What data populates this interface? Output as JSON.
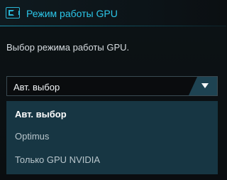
{
  "header": {
    "title": "Режим работы GPU",
    "icon": "gpu-icon",
    "accent_color": "#2cc7ea"
  },
  "description": "Выбор режима работы GPU.",
  "gpu_mode_select": {
    "selected_value": "Авт. выбор",
    "options": [
      {
        "label": "Авт. выбор",
        "selected": true
      },
      {
        "label": "Optimus",
        "selected": false
      },
      {
        "label": "Только GPU NVIDIA",
        "selected": false
      }
    ]
  }
}
